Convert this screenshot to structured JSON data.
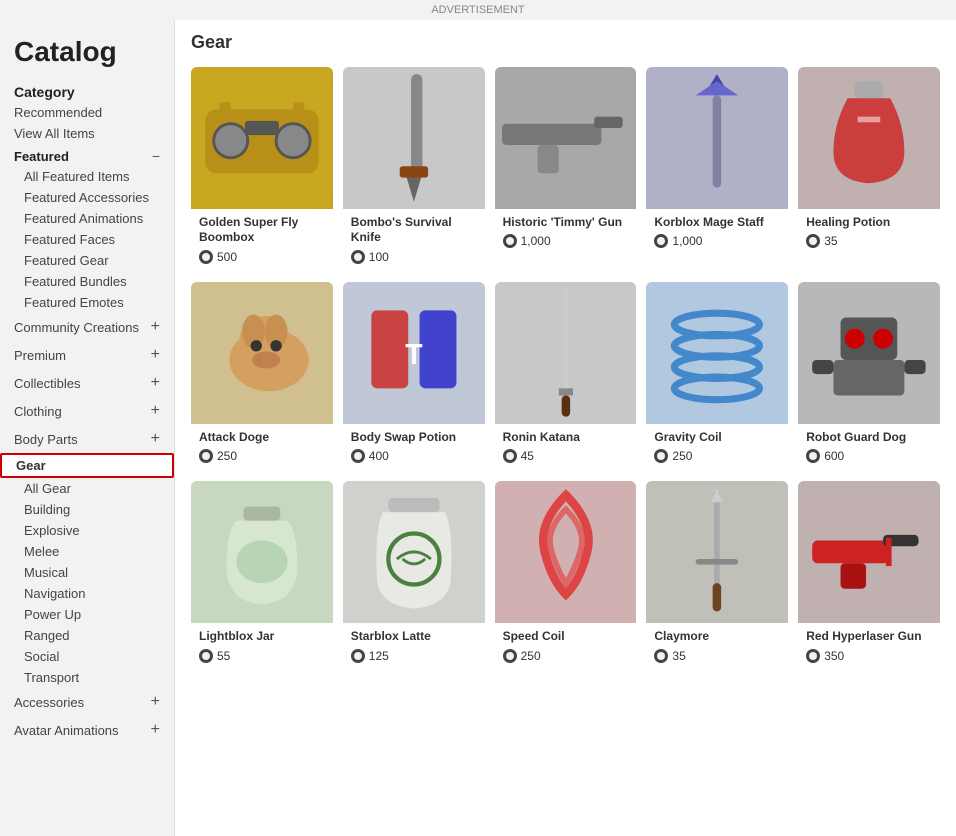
{
  "app": {
    "title": "Catalog",
    "ad_label": "ADVERTISEMENT"
  },
  "sidebar": {
    "category_label": "Category",
    "items": [
      {
        "id": "recommended",
        "label": "Recommended",
        "type": "top"
      },
      {
        "id": "view-all",
        "label": "View All Items",
        "type": "top"
      },
      {
        "id": "featured-header",
        "label": "Featured",
        "type": "featured-header"
      },
      {
        "id": "all-featured",
        "label": "All Featured Items",
        "type": "sub"
      },
      {
        "id": "featured-accessories",
        "label": "Featured Accessories",
        "type": "sub"
      },
      {
        "id": "featured-animations",
        "label": "Featured Animations",
        "type": "sub"
      },
      {
        "id": "featured-faces",
        "label": "Featured Faces",
        "type": "sub"
      },
      {
        "id": "featured-gear",
        "label": "Featured Gear",
        "type": "sub"
      },
      {
        "id": "featured-bundles",
        "label": "Featured Bundles",
        "type": "sub"
      },
      {
        "id": "featured-emotes",
        "label": "Featured Emotes",
        "type": "sub"
      },
      {
        "id": "community-creations",
        "label": "Community Creations",
        "type": "category-plus"
      },
      {
        "id": "premium",
        "label": "Premium",
        "type": "category-plus"
      },
      {
        "id": "collectibles",
        "label": "Collectibles",
        "type": "category-plus"
      },
      {
        "id": "clothing",
        "label": "Clothing",
        "type": "category-plus"
      },
      {
        "id": "body-parts",
        "label": "Body Parts",
        "type": "category-plus"
      },
      {
        "id": "gear",
        "label": "Gear",
        "type": "active"
      },
      {
        "id": "all-gear",
        "label": "All Gear",
        "type": "sub"
      },
      {
        "id": "building",
        "label": "Building",
        "type": "sub"
      },
      {
        "id": "explosive",
        "label": "Explosive",
        "type": "sub"
      },
      {
        "id": "melee",
        "label": "Melee",
        "type": "sub"
      },
      {
        "id": "musical",
        "label": "Musical",
        "type": "sub"
      },
      {
        "id": "navigation",
        "label": "Navigation",
        "type": "sub"
      },
      {
        "id": "power-up",
        "label": "Power Up",
        "type": "sub"
      },
      {
        "id": "ranged",
        "label": "Ranged",
        "type": "sub"
      },
      {
        "id": "social",
        "label": "Social",
        "type": "sub"
      },
      {
        "id": "transport",
        "label": "Transport",
        "type": "sub"
      },
      {
        "id": "accessories",
        "label": "Accessories",
        "type": "category-plus"
      },
      {
        "id": "avatar-animations",
        "label": "Avatar Animations",
        "type": "category-plus"
      }
    ]
  },
  "main": {
    "section_title": "Gear",
    "items": [
      {
        "id": 1,
        "name": "Golden Super Fly Boombox",
        "price": "500",
        "thumb_class": "thumb-boombox"
      },
      {
        "id": 2,
        "name": "Bombo's Survival Knife",
        "price": "100",
        "thumb_class": "thumb-knife"
      },
      {
        "id": 3,
        "name": "Historic 'Timmy' Gun",
        "price": "1,000",
        "thumb_class": "thumb-gun"
      },
      {
        "id": 4,
        "name": "Korblox Mage Staff",
        "price": "1,000",
        "thumb_class": "thumb-staff"
      },
      {
        "id": 5,
        "name": "Healing Potion",
        "price": "35",
        "thumb_class": "thumb-potion"
      },
      {
        "id": 6,
        "name": "Attack Doge",
        "price": "250",
        "thumb_class": "thumb-doge"
      },
      {
        "id": 7,
        "name": "Body Swap Potion",
        "price": "400",
        "thumb_class": "thumb-potion2"
      },
      {
        "id": 8,
        "name": "Ronin Katana",
        "price": "45",
        "thumb_class": "thumb-katana"
      },
      {
        "id": 9,
        "name": "Gravity Coil",
        "price": "250",
        "thumb_class": "thumb-coil"
      },
      {
        "id": 10,
        "name": "Robot Guard Dog",
        "price": "600",
        "thumb_class": "thumb-robot"
      },
      {
        "id": 11,
        "name": "Lightblox Jar",
        "price": "55",
        "thumb_class": "thumb-jar"
      },
      {
        "id": 12,
        "name": "Starblox Latte",
        "price": "125",
        "thumb_class": "thumb-latte"
      },
      {
        "id": 13,
        "name": "Speed Coil",
        "price": "250",
        "thumb_class": "thumb-speedcoil"
      },
      {
        "id": 14,
        "name": "Claymore",
        "price": "35",
        "thumb_class": "thumb-claymore"
      },
      {
        "id": 15,
        "name": "Red Hyperlaser Gun",
        "price": "350",
        "thumb_class": "thumb-laser"
      }
    ]
  }
}
